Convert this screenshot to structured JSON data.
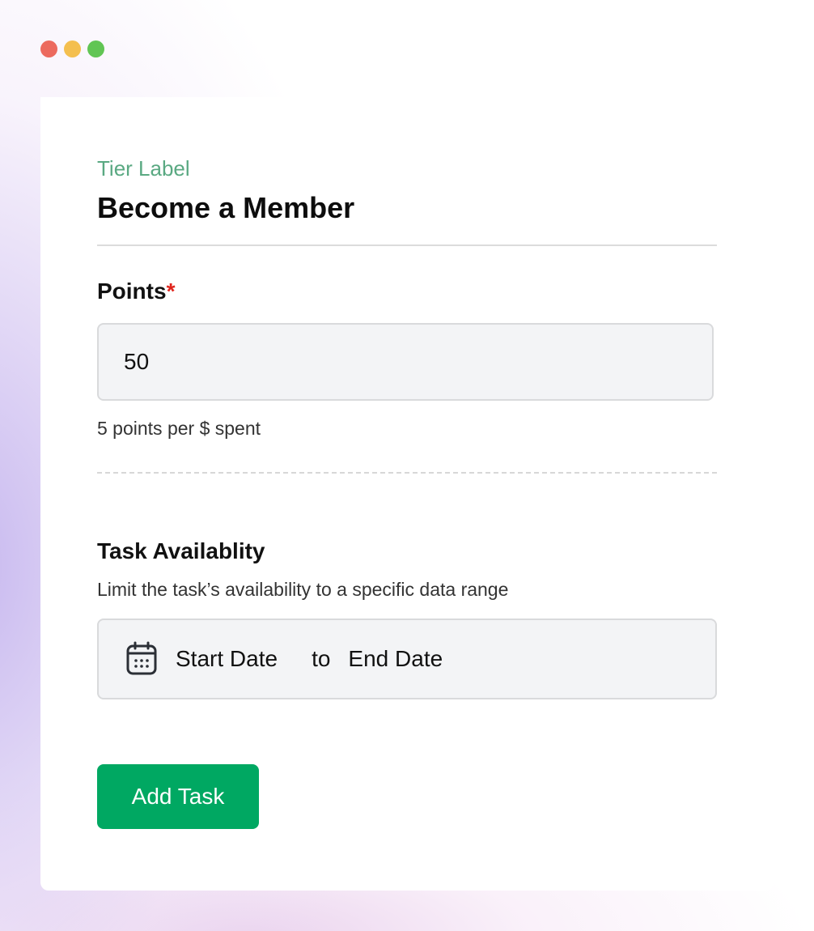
{
  "window": {
    "controls": [
      "close",
      "minimize",
      "maximize"
    ]
  },
  "form": {
    "tier_label": "Tier Label",
    "title": "Become a Member",
    "points": {
      "label": "Points",
      "required_marker": "*",
      "value": "50",
      "helper": "5 points per $ spent"
    },
    "availability": {
      "label": "Task Availablity",
      "description": "Limit the task’s availability to a specific data range",
      "icon": "calendar-icon",
      "start_placeholder": "Start Date",
      "separator": "to",
      "end_placeholder": "End Date"
    },
    "submit_label": "Add Task"
  },
  "colors": {
    "accent_green": "#00a862",
    "tier_label_green": "#5aa982",
    "required_red": "#e0241c"
  }
}
